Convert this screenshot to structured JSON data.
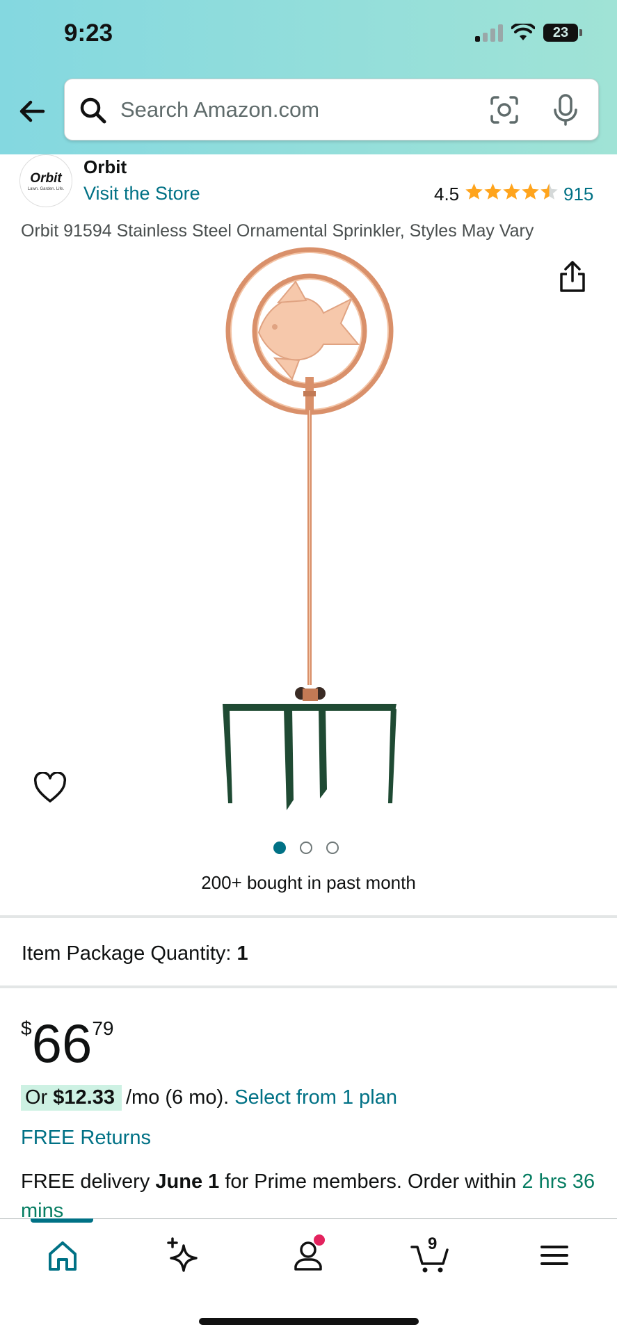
{
  "status_bar": {
    "time": "9:23",
    "battery": "23"
  },
  "search": {
    "placeholder": "Search Amazon.com"
  },
  "brand": {
    "logo_text": "Orbit",
    "logo_tagline": "Lawn. Garden. Life.",
    "name": "Orbit",
    "store_link": "Visit the Store"
  },
  "rating": {
    "value": "4.5",
    "stars": 4.5,
    "count": "915"
  },
  "product": {
    "title": "Orbit 91594 Stainless Steel Ornamental Sprinkler, Styles May Vary",
    "image_index": 1,
    "image_total": 3,
    "bought_text": "200+ bought in past month"
  },
  "quantity": {
    "label": "Item Package Quantity:",
    "value": "1"
  },
  "price": {
    "symbol": "$",
    "whole": "66",
    "fraction": "79"
  },
  "installment": {
    "prefix": "Or",
    "amount": "$12.33",
    "term": "/mo (6 mo).",
    "plan_link": "Select from 1 plan"
  },
  "returns": "FREE Returns",
  "delivery": {
    "part1": "FREE delivery ",
    "date": "June 1",
    "part2": " for Prime members. Order within ",
    "countdown": "2 hrs 36 mins"
  },
  "bottom_nav": {
    "items": [
      {
        "icon": "home-icon",
        "active": true
      },
      {
        "icon": "rufus-sparkle-icon"
      },
      {
        "icon": "account-icon",
        "badge": true
      },
      {
        "icon": "cart-icon",
        "count": "9"
      },
      {
        "icon": "menu-icon"
      }
    ]
  },
  "colors": {
    "accent": "#007185",
    "header_start": "#84d8e0",
    "header_end": "#a0e3d6",
    "star": "#ffa41c",
    "badge": "#e3235e",
    "copper": "#d9906a",
    "prongs": "#1f4a33"
  }
}
